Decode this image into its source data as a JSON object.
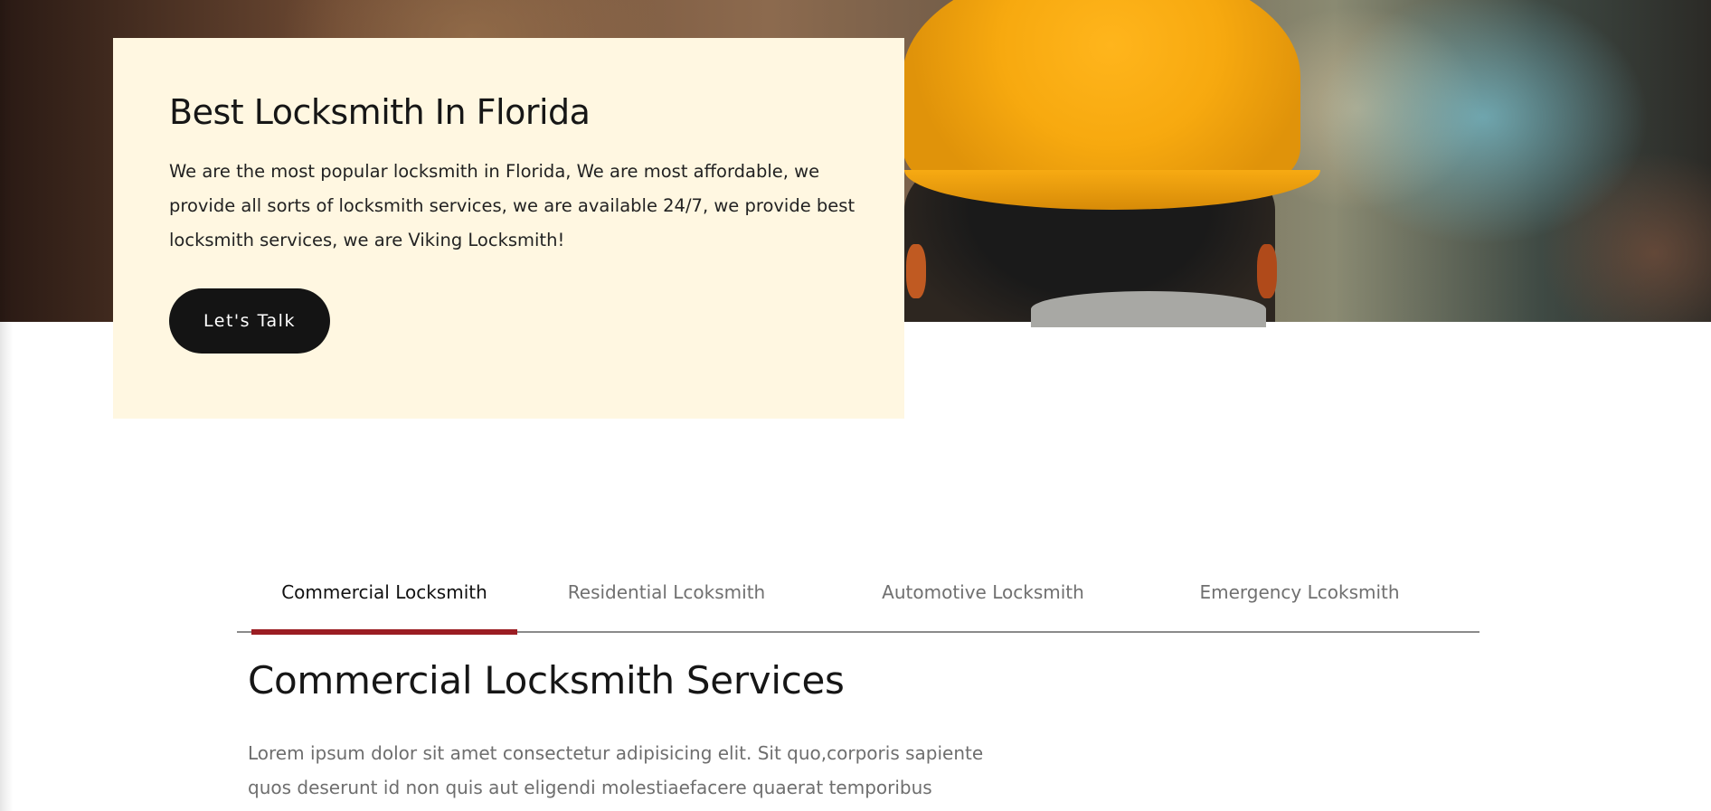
{
  "hero": {
    "title": "Best Locksmith In Florida",
    "description": "We are the most popular locksmith in Florida, We are most affordable, we provide all sorts of locksmith services, we are available 24/7, we provide best locksmith services, we are Viking Locksmith!",
    "cta_label": "Let's Talk"
  },
  "tabs": [
    {
      "label": "Commercial Locksmith",
      "active": true
    },
    {
      "label": "Residential Lcoksmith",
      "active": false
    },
    {
      "label": "Automotive Locksmith",
      "active": false
    },
    {
      "label": "Emergency Lcoksmith",
      "active": false
    }
  ],
  "content": {
    "title": "Commercial Locksmith Services",
    "text": "Lorem ipsum dolor sit amet consectetur adipisicing elit. Sit quo,corporis sapiente quos deserunt id non quis aut eligendi molestiaefacere quaerat temporibus"
  },
  "colors": {
    "card_background": "#fff7e1",
    "button_background": "#141414",
    "tab_active_indicator": "#9b1d23"
  }
}
